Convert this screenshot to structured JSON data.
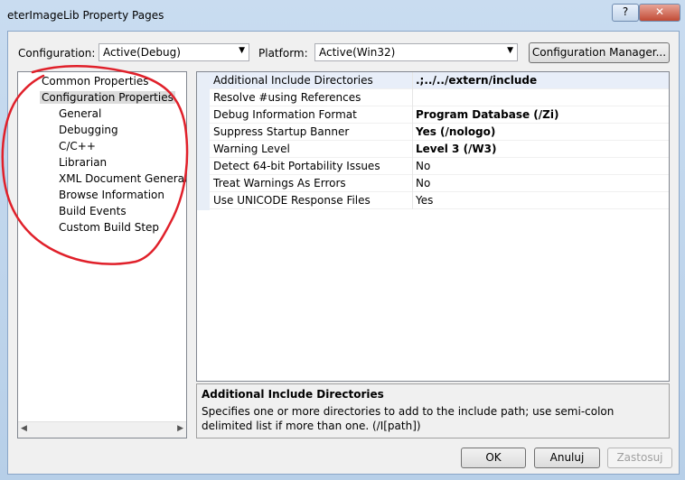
{
  "window": {
    "title": "eterImageLib Property Pages",
    "help_label": "?",
    "close_label": "✕"
  },
  "header": {
    "configuration_label": "Configuration:",
    "configuration_value": "Active(Debug)",
    "platform_label": "Platform:",
    "platform_value": "Active(Win32)",
    "config_manager_label": "Configuration Manager..."
  },
  "tree": {
    "items": [
      {
        "label": "Common Properties"
      },
      {
        "label": "Configuration Properties"
      },
      {
        "label": "General"
      },
      {
        "label": "Debugging"
      },
      {
        "label": "C/C++"
      },
      {
        "label": "Librarian"
      },
      {
        "label": "XML Document Generator"
      },
      {
        "label": "Browse Information"
      },
      {
        "label": "Build Events"
      },
      {
        "label": "Custom Build Step"
      }
    ]
  },
  "properties": {
    "rows": [
      {
        "name": "Additional Include Directories",
        "value": ".;../../extern/include"
      },
      {
        "name": "Resolve #using References",
        "value": ""
      },
      {
        "name": "Debug Information Format",
        "value": "Program Database (/Zi)"
      },
      {
        "name": "Suppress Startup Banner",
        "value": "Yes (/nologo)"
      },
      {
        "name": "Warning Level",
        "value": "Level 3 (/W3)"
      },
      {
        "name": "Detect 64-bit Portability Issues",
        "value": "No"
      },
      {
        "name": "Treat Warnings As Errors",
        "value": "No"
      },
      {
        "name": "Use UNICODE Response Files",
        "value": "Yes"
      }
    ]
  },
  "description": {
    "title": "Additional Include Directories",
    "text": "Specifies one or more directories to add to the include path; use semi-colon delimited list if more than one.     (/I[path])"
  },
  "buttons": {
    "ok": "OK",
    "cancel": "Anuluj",
    "apply": "Zastosuj"
  },
  "annotation": {
    "color": "#e0202a"
  }
}
